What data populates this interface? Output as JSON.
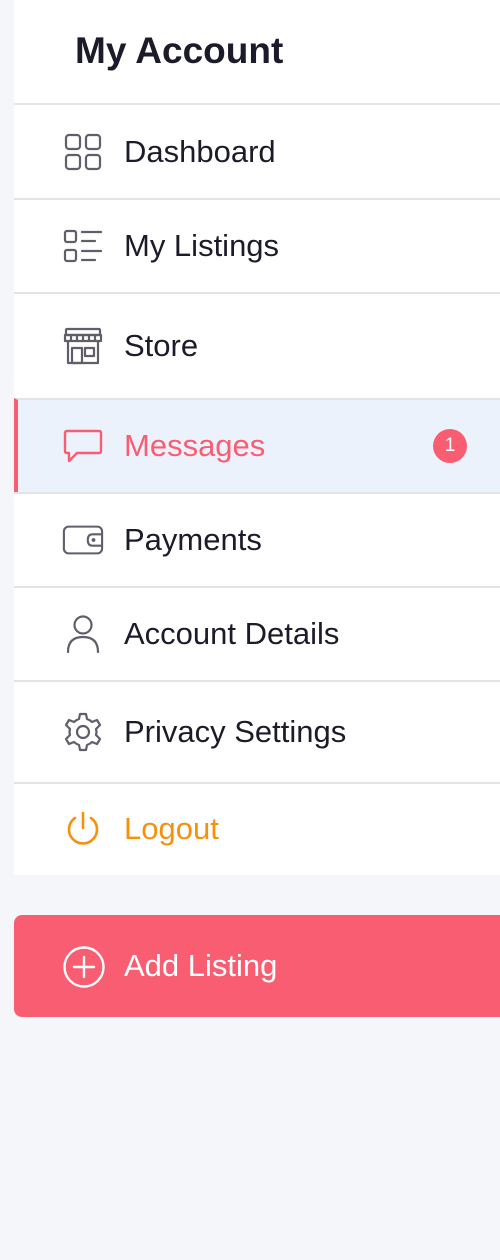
{
  "sidebar": {
    "title": "My Account",
    "items": [
      {
        "label": "Dashboard",
        "icon": "dashboard-grid-icon"
      },
      {
        "label": "My Listings",
        "icon": "listings-list-icon"
      },
      {
        "label": "Store",
        "icon": "store-icon"
      },
      {
        "label": "Messages",
        "icon": "message-bubble-icon",
        "badge": "1",
        "active": true
      },
      {
        "label": "Payments",
        "icon": "wallet-icon"
      },
      {
        "label": "Account Details",
        "icon": "user-icon"
      },
      {
        "label": "Privacy Settings",
        "icon": "gear-icon"
      },
      {
        "label": "Logout",
        "icon": "power-icon"
      }
    ]
  },
  "add_listing": {
    "label": "Add Listing",
    "icon": "plus-circle-icon"
  },
  "colors": {
    "accent": "#f85d72",
    "logout": "#f7900b",
    "active_background": "#ebf2fc",
    "page_background": "#f5f6fa",
    "text": "#1b1b2a",
    "icon": "#5f5f6b",
    "divider": "#e3e4e8"
  }
}
